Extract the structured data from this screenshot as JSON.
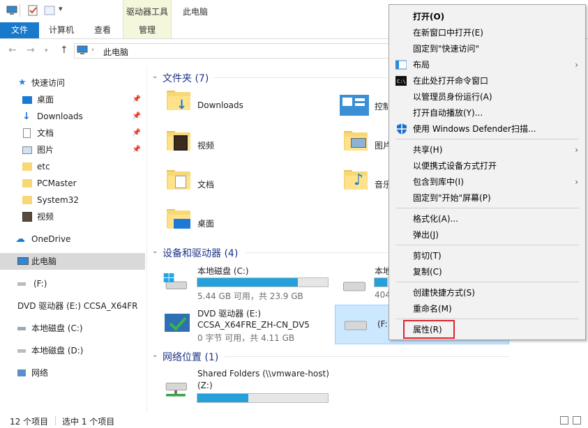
{
  "ribbon": {
    "file_tab": "文件",
    "tabs": [
      "计算机",
      "查看"
    ],
    "context_group": "驱动器工具",
    "context_tab": "管理",
    "window_title": "此电脑"
  },
  "address": {
    "path": "此电脑"
  },
  "sidebar": {
    "items": [
      {
        "label": "快速访问",
        "icon": "star-icon"
      },
      {
        "label": "桌面",
        "icon": "desktop-icon",
        "pinned": true
      },
      {
        "label": "Downloads",
        "icon": "download-icon",
        "pinned": true
      },
      {
        "label": "文档",
        "icon": "document-icon",
        "pinned": true
      },
      {
        "label": "图片",
        "icon": "picture-icon",
        "pinned": true
      },
      {
        "label": "etc",
        "icon": "folder-icon"
      },
      {
        "label": "PCMaster",
        "icon": "folder-icon"
      },
      {
        "label": "System32",
        "icon": "folder-icon"
      },
      {
        "label": "视频",
        "icon": "video-icon"
      },
      {
        "label": "OneDrive",
        "icon": "cloud-icon"
      },
      {
        "label": "此电脑",
        "icon": "computer-icon",
        "selected": true
      },
      {
        "label": "(F:)",
        "icon": "drive-icon"
      },
      {
        "label": "DVD 驱动器 (E:) CCSA_X64FR",
        "icon": "dvd-icon"
      },
      {
        "label": "本地磁盘 (C:)",
        "icon": "drive-icon"
      },
      {
        "label": "本地磁盘 (D:)",
        "icon": "drive-icon"
      },
      {
        "label": "网络",
        "icon": "network-icon"
      }
    ]
  },
  "main": {
    "folders_header": "文件夹 (7)",
    "folders": [
      "Downloads",
      "视频",
      "文档",
      "桌面",
      "控制",
      "图片",
      "音乐"
    ],
    "devices_header": "设备和驱动器 (4)",
    "drives": [
      {
        "name": "本地磁盘 (C:)",
        "detail": "5.44 GB 可用，共 23.9 GB",
        "used_fraction": 0.77
      },
      {
        "name": "本地",
        "detail": "404",
        "used_fraction": 0.1
      },
      {
        "name": "DVD 驱动器 (E:)",
        "name2": "CCSA_X64FRE_ZH-CN_DV5",
        "detail": "0 字节 可用，共 4.11 GB"
      },
      {
        "name": "(F:)"
      }
    ],
    "network_header": "网络位置 (1)",
    "network": {
      "name": "Shared Folders (\\\\vmware-host)",
      "name2": "(Z:)",
      "used_fraction": 0.39
    }
  },
  "status": {
    "count": "12 个项目",
    "selected": "选中 1 个项目"
  },
  "context_menu": {
    "items": [
      {
        "label": "打开(O)",
        "bold": true
      },
      {
        "label": "在新窗口中打开(E)"
      },
      {
        "label": "固定到\"快速访问\""
      },
      {
        "label": "布局",
        "submenu": true,
        "icon": "layout-icon"
      },
      {
        "label": "在此处打开命令窗口",
        "icon": "cmd-icon"
      },
      {
        "label": "以管理员身份运行(A)"
      },
      {
        "label": "打开自动播放(Y)..."
      },
      {
        "label": "使用 Windows Defender扫描...",
        "icon": "defender-shield-icon"
      },
      {
        "label": "共享(H)",
        "submenu": true
      },
      {
        "label": "以便携式设备方式打开"
      },
      {
        "label": "包含到库中(I)",
        "submenu": true
      },
      {
        "label": "固定到\"开始\"屏幕(P)"
      },
      {
        "label": "格式化(A)..."
      },
      {
        "label": "弹出(J)"
      },
      {
        "label": "剪切(T)"
      },
      {
        "label": "复制(C)"
      },
      {
        "label": "创建快捷方式(S)"
      },
      {
        "label": "重命名(M)"
      },
      {
        "label": "属性(R)"
      }
    ]
  },
  "colors": {
    "accent": "#1979ca",
    "bar_fill": "#26a0da",
    "highlight_box": "#e0232d"
  }
}
